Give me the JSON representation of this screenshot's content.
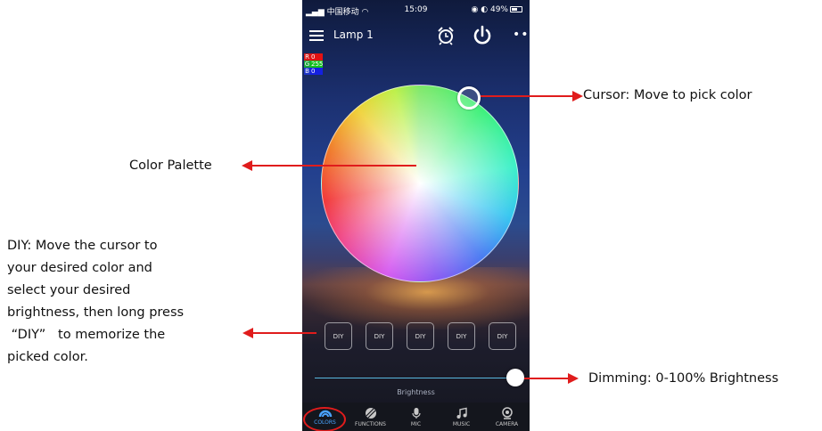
{
  "status_bar": {
    "carrier": "中国移动",
    "time": "15:09",
    "battery": "49%"
  },
  "topbar": {
    "device_name": "Lamp 1"
  },
  "rgb_readout": {
    "r_label": "R",
    "r": "0",
    "g_label": "G",
    "g": "255",
    "b_label": "B",
    "b": "0"
  },
  "diy_buttons": [
    "DIY",
    "DIY",
    "DIY",
    "DIY",
    "DIY"
  ],
  "brightness": {
    "label": "Brightness",
    "value": 1.0
  },
  "tabs": [
    {
      "label": "COLORS",
      "icon": "rainbow-icon",
      "active": true
    },
    {
      "label": "FUNCTIONS",
      "icon": "striped-circle-icon",
      "active": false
    },
    {
      "label": "MIC",
      "icon": "microphone-icon",
      "active": false
    },
    {
      "label": "MUSIC",
      "icon": "music-note-icon",
      "active": false
    },
    {
      "label": "CAMERA",
      "icon": "camera-icon",
      "active": false
    }
  ],
  "annotations": {
    "cursor": "Cursor: Move to pick color",
    "palette": "Color Palette",
    "diy_lines": [
      "DIY: Move the cursor to",
      "your desired color and",
      "select your desired",
      "brightness, then long press",
      " “DIY”   to memorize the",
      "picked color."
    ],
    "dimming": "Dimming: 0-100% Brightness"
  },
  "colors": {
    "annotation_arrow": "#e01c1c",
    "active_tab": "#4aa3ff",
    "slider_track": "#58b8e0"
  }
}
